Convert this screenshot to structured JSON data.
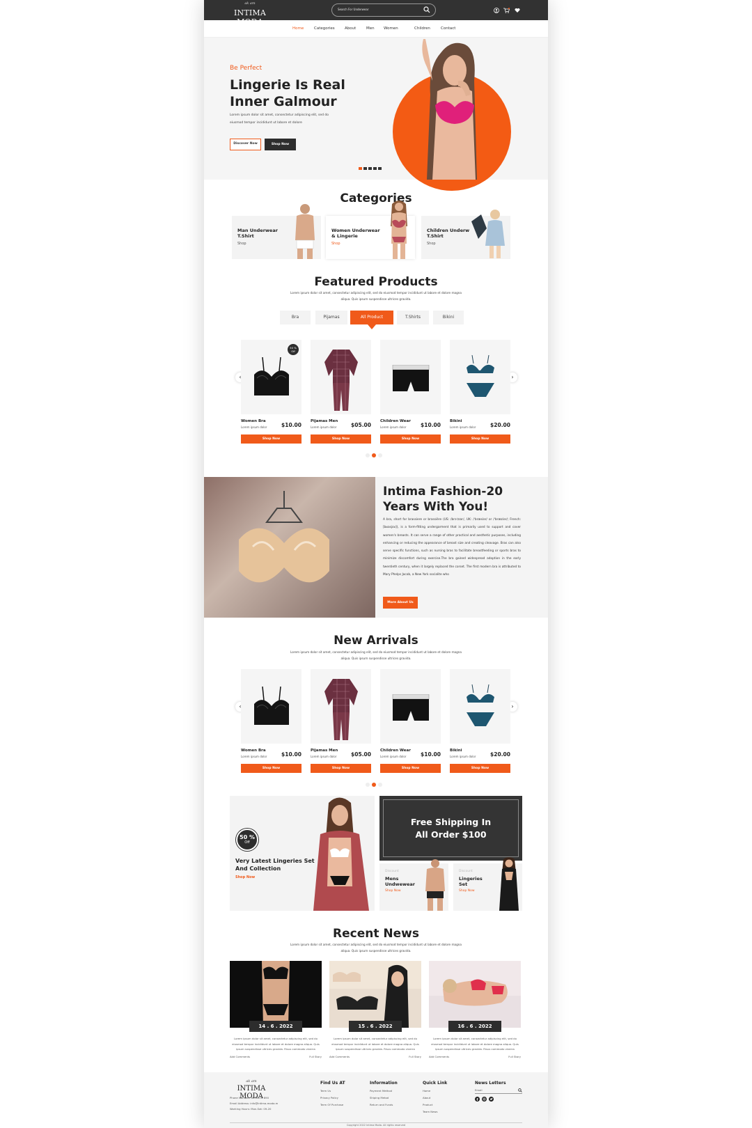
{
  "header": {
    "logo_script": "ak  am",
    "logo_text": "INTIMA MODA",
    "search_placeholder": "Search For Underwear"
  },
  "nav": [
    "Home",
    "Categories",
    "About",
    "Men",
    "Women",
    "Children",
    "Contact"
  ],
  "hero": {
    "kicker": "Be Perfect",
    "title_line1": "Lingerie Is Real",
    "title_line2": "Inner Galmour",
    "text": "Lorem ipsum dolor sit amet, consectetur adipiscing elit, sed do eiusmod tempor incididunt ut labore et dolore",
    "btn_discover": "Discover Now",
    "btn_shop": "Shop Now"
  },
  "categories": {
    "title": "Categories",
    "items": [
      {
        "line1": "Man Underwear",
        "line2": "T.Shirt",
        "shop": "Shop"
      },
      {
        "line1": "Women Underwear",
        "line2": "& Lingerie",
        "shop": "Shop"
      },
      {
        "line1": "Children Underw",
        "line2": "T.Shirt",
        "shop": "Shop"
      }
    ]
  },
  "featured": {
    "title": "Featured Products",
    "subtitle": "Lorem ipsum dolor sit amet, consectetur adipiscing elit, sed do eiusmod tempor incididunt ut labore et dolore magna aliqua. Quis ipsum suspendisse ultrices gravida.",
    "tabs": [
      "Bra",
      "Pijamas",
      "All Product",
      "T.Shirts",
      "Bikini"
    ],
    "badge": "50 % Off"
  },
  "products": [
    {
      "name": "Women Bra",
      "desc": "Lorem ipsum dolor",
      "price": "$10.00",
      "btn": "Shop Now"
    },
    {
      "name": "Pijamas Men",
      "desc": "Lorem ipsum dolor",
      "price": "$05.00",
      "btn": "Shop Now"
    },
    {
      "name": "Children Wear",
      "desc": "Lorem ipsum dolor",
      "price": "$10.00",
      "btn": "Shop Now"
    },
    {
      "name": "Bikini",
      "desc": "Lorem ipsum dolor",
      "price": "$20.00",
      "btn": "Shop Now"
    }
  ],
  "about": {
    "title_line1": "Intima Fashion-20",
    "title_line2": "Years With You!",
    "text": "A bra, short for brassiere or brassière (US: /brəˈzɪər/, UK: /ˈbræsiər/ or /ˈbræziər/; French: [bʁasjɛʁ]), is a form-fitting undergarment that is primarily used to support and cover women's breasts. It can serve a range of other practical and aesthetic purposes, including enhancing or reducing the appearance of breast size and creating cleavage. Bras can also serve specific functions, such as nursing bras to facilitate breastfeeding or sports bras to minimize discomfort during exercise.The bra gained widespread adoption in the early twentieth century, when it largely replaced the corset. The first modern bra is attributed to Mary Phelps Jacob, a New York socialite who",
    "btn": "More About Us"
  },
  "arrivals": {
    "title": "New Arrivals",
    "subtitle": "Lorem ipsum dolor sit amet, consectetur adipiscing elit, sed do eiusmod tempor incididunt ut labore et dolore magna aliqua. Quis ipsum suspendisse ultrices gravida."
  },
  "promos": {
    "badge_pct": "50 %",
    "badge_off": "Off",
    "title": "Very Latest Lingeries Set And Collection",
    "shop": "Shop Now",
    "ship_line1": "Free Shipping In",
    "ship_line2": "All Order $100",
    "mini": [
      {
        "disc": "Discount",
        "line1": "Mens",
        "line2": "Undwewear",
        "shop": "Shop Now"
      },
      {
        "disc": "Discount",
        "line1": "Lingeries",
        "line2": "Set",
        "shop": "Shop Now"
      }
    ]
  },
  "news": {
    "title": "Recent News",
    "subtitle": "Lorem ipsum dolor sit amet, consectetur adipiscing elit, sed do eiusmod tempor incididunt ut labore et dolore magna aliqua. Quis ipsum suspendisse ultrices gravida.",
    "items": [
      {
        "date": "14 . 6 . 2022",
        "text": "Lorem ipsum dolor sit amet, consectetur adipiscing elit, sed do eiusmod tempor incididunt ut labore et dolore magna aliqua. Quis ipsum suspendisse ultrices gravida. Risus commodo viverra",
        "comments": "Add Comments",
        "more": "Full Story"
      },
      {
        "date": "15 . 6 . 2022",
        "text": "Lorem ipsum dolor sit amet, consectetur adipiscing elit, sed do eiusmod tempor incididunt ut labore et dolore magna aliqua. Quis ipsum suspendisse ultrices gravida. Risus commodo viverra",
        "comments": "Add Comments",
        "more": "Full Story"
      },
      {
        "date": "16 . 6 . 2022",
        "text": "Lorem ipsum dolor sit amet, consectetur adipiscing elit, sed do eiusmod tempor incididunt ut labore et dolore magna aliqua. Quis ipsum suspendisse ultrices gravida. Risus commodo viverra",
        "comments": "Add Comments",
        "more": "Full Story"
      }
    ]
  },
  "footer": {
    "logo_script": "ak  am",
    "logo": "INTIMA MODA",
    "contact": [
      "Phone Number: 0078170 890",
      "Email Address: info@intima-moda.m",
      "Working Hours: Mon-Sat: 09-20"
    ],
    "find_us": {
      "title": "Find Us AT",
      "items": [
        "Term Us",
        "Privacy Policy",
        "Term Of Purchase"
      ]
    },
    "information": {
      "title": "Information",
      "items": [
        "Payment Method",
        "Shiping Metod",
        "Return and Funds"
      ]
    },
    "quick": {
      "title": "Quick Link",
      "items": [
        "Home",
        "About",
        "Product",
        "Team News"
      ]
    },
    "newsletter": {
      "title": "News Letters",
      "placeholder": "Email"
    },
    "copyright": "Copyright 2022 Intima Moda. All rights reserved"
  },
  "colors": {
    "accent": "#f05a1a",
    "dark": "#2d2d2d",
    "light_bg": "#f4f4f4"
  }
}
